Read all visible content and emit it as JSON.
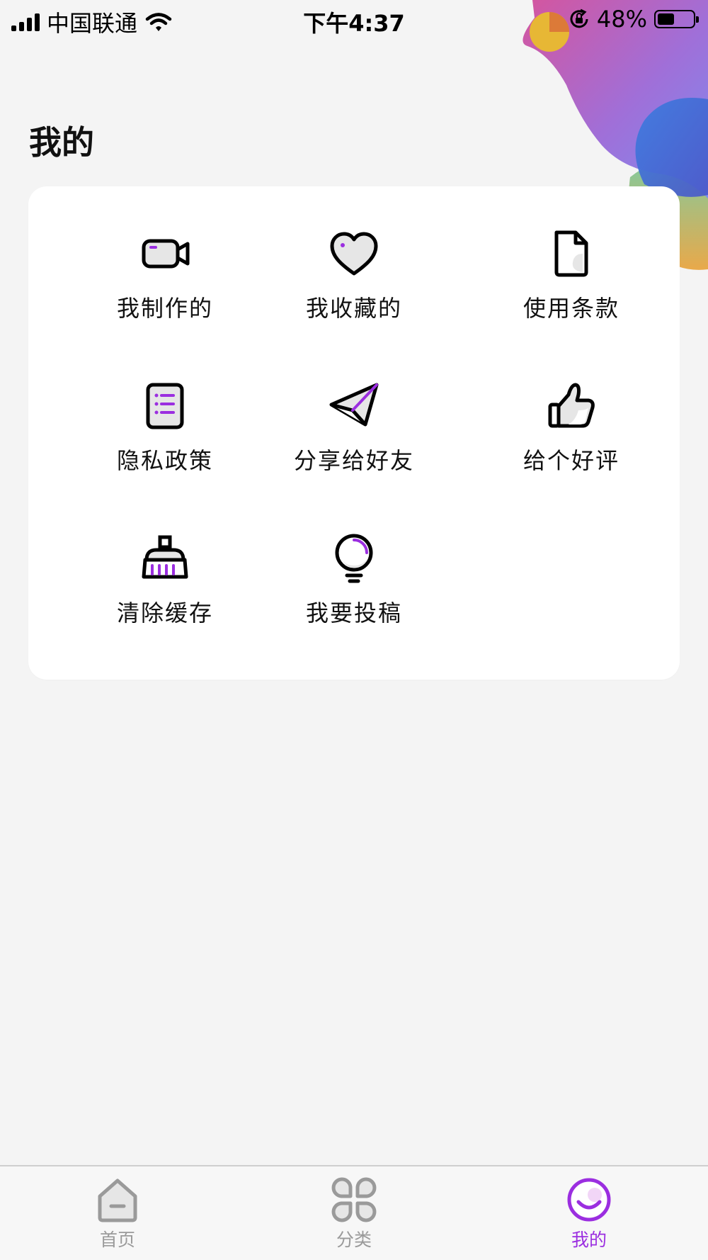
{
  "status_bar": {
    "carrier": "中国联通",
    "time": "下午4:37",
    "battery": "48%",
    "battery_level": 0.48
  },
  "page_title": "我的",
  "menu": {
    "items": [
      {
        "label": "我制作的",
        "icon": "video-camera-icon"
      },
      {
        "label": "我收藏的",
        "icon": "heart-icon"
      },
      {
        "label": "使用条款",
        "icon": "document-icon"
      },
      {
        "label": "隐私政策",
        "icon": "list-document-icon"
      },
      {
        "label": "分享给好友",
        "icon": "paper-plane-icon"
      },
      {
        "label": "给个好评",
        "icon": "thumbs-up-icon"
      },
      {
        "label": "清除缓存",
        "icon": "broom-icon"
      },
      {
        "label": "我要投稿",
        "icon": "light-bulb-icon"
      }
    ]
  },
  "tab_bar": {
    "tabs": [
      {
        "label": "首页",
        "icon": "home-icon",
        "active": false
      },
      {
        "label": "分类",
        "icon": "category-grid-icon",
        "active": false
      },
      {
        "label": "我的",
        "icon": "profile-smile-icon",
        "active": true
      }
    ]
  },
  "colors": {
    "accent": "#9b2ee0",
    "background": "#f4f4f4",
    "card": "#ffffff",
    "icon_fill": "#e6e6e6",
    "inactive_tab": "#9a9a9a"
  }
}
